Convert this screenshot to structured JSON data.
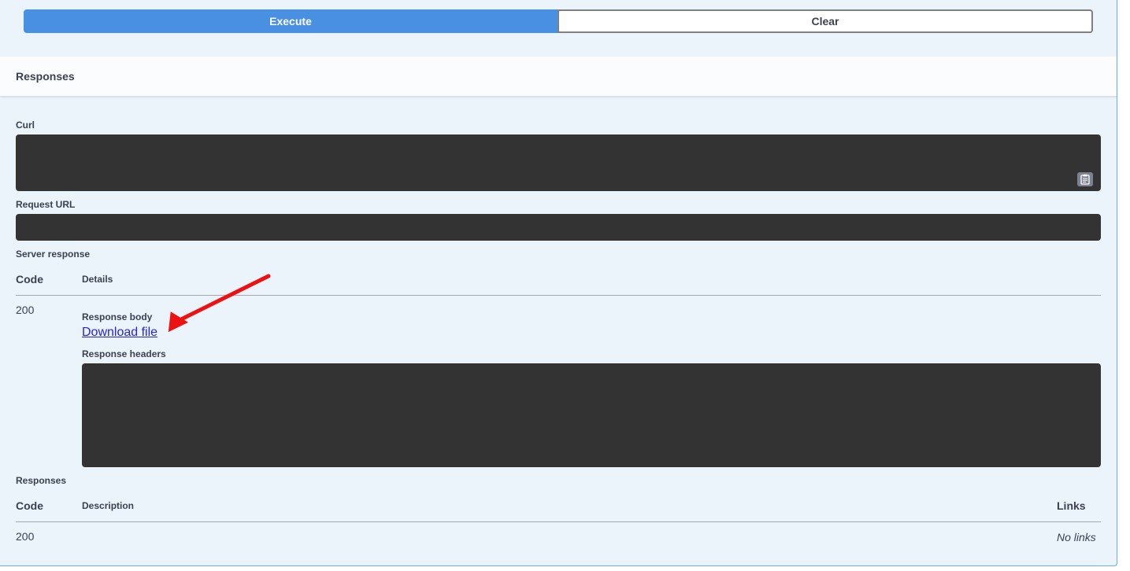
{
  "actions": {
    "execute_label": "Execute",
    "clear_label": "Clear"
  },
  "responses_section": {
    "title": "Responses"
  },
  "curl": {
    "label": "Curl"
  },
  "request_url": {
    "label": "Request URL"
  },
  "server_response": {
    "label": "Server response",
    "code_header": "Code",
    "details_header": "Details",
    "row": {
      "code": "200",
      "body_label": "Response body",
      "download_link": "Download file",
      "headers_label": "Response headers"
    }
  },
  "responses_table": {
    "label": "Responses",
    "code_header": "Code",
    "description_header": "Description",
    "links_header": "Links",
    "row": {
      "code": "200",
      "links": "No links"
    }
  },
  "colors": {
    "execute_bg": "#4990e2",
    "panel_bg": "#ebf3fb",
    "dark_box": "#333333",
    "link": "#2424dd",
    "annotation_arrow": "#ee1111"
  },
  "icons": {
    "copy": "clipboard-copy-icon",
    "annotation": "red-arrow-annotation"
  }
}
